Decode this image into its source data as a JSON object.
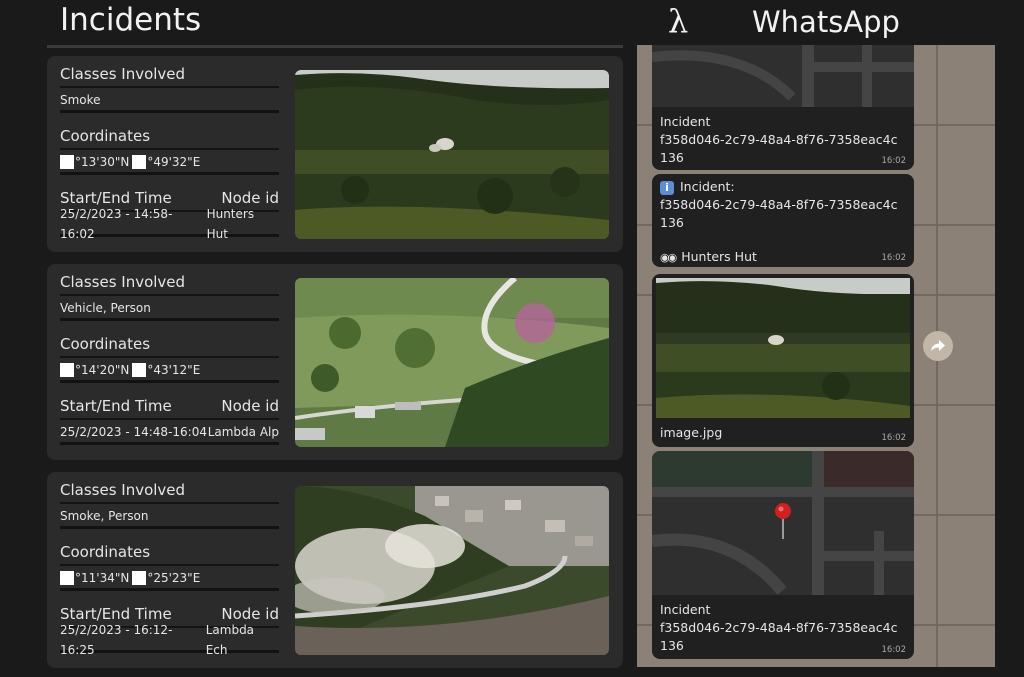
{
  "header": {
    "left_title": "Incidents",
    "right_logo": "λ",
    "right_title": "WhatsApp"
  },
  "incidents": [
    {
      "classes_label": "Classes Involved",
      "classes_value": "Smoke",
      "coordinates_label": "Coordinates",
      "lat": "°13'30\"N",
      "lon": "°49'32\"E",
      "time_label": "Start/End Time",
      "node_label": "Node id",
      "time_value": "25/2/2023 - 14:58-16:02",
      "node_value": "Hunters Hut",
      "image": "hillside-smoke-photo"
    },
    {
      "classes_label": "Classes Involved",
      "classes_value": "Vehicle, Person",
      "coordinates_label": "Coordinates",
      "lat": "°14'20\"N",
      "lon": "°43'12\"E",
      "time_label": "Start/End Time",
      "node_label": "Node id",
      "time_value": "25/2/2023 - 14:48-16:04",
      "node_value": "Lambda Alp",
      "image": "valley-road-photo"
    },
    {
      "classes_label": "Classes Involved",
      "classes_value": "Smoke, Person",
      "coordinates_label": "Coordinates",
      "lat": "°11'34\"N",
      "lon": "°25'23\"E",
      "time_label": "Start/End Time",
      "node_label": "Node id",
      "time_value": "25/2/2023 - 16:12-16:25",
      "node_value": "Lambda Ech",
      "image": "coastal-road-smoke-photo"
    }
  ],
  "whatsapp": {
    "messages": [
      {
        "type": "location",
        "line1": "Incident",
        "line2": "f358d046-2c79-48a4-8f76-7358eac4c",
        "line3": "136",
        "time": "16:02"
      },
      {
        "type": "text",
        "line1": "Incident:",
        "line2": "f358d046-2c79-48a4-8f76-7358eac4c",
        "line3": "136",
        "line4": "Hunters Hut",
        "time": "16:02"
      },
      {
        "type": "image",
        "caption": "image.jpg",
        "time": "16:02"
      },
      {
        "type": "location",
        "line1": "Incident",
        "line2": "f358d046-2c79-48a4-8f76-7358eac4c",
        "line3": "136",
        "time": "16:02"
      }
    ],
    "icons": {
      "info": "info-icon",
      "eyes": "eyes-icon",
      "forward": "forward-icon",
      "pin": "map-pin-icon"
    },
    "colors": {
      "bubble": "#202020",
      "wallpaper": "#8a7f74",
      "pin": "#d21f1f"
    }
  }
}
